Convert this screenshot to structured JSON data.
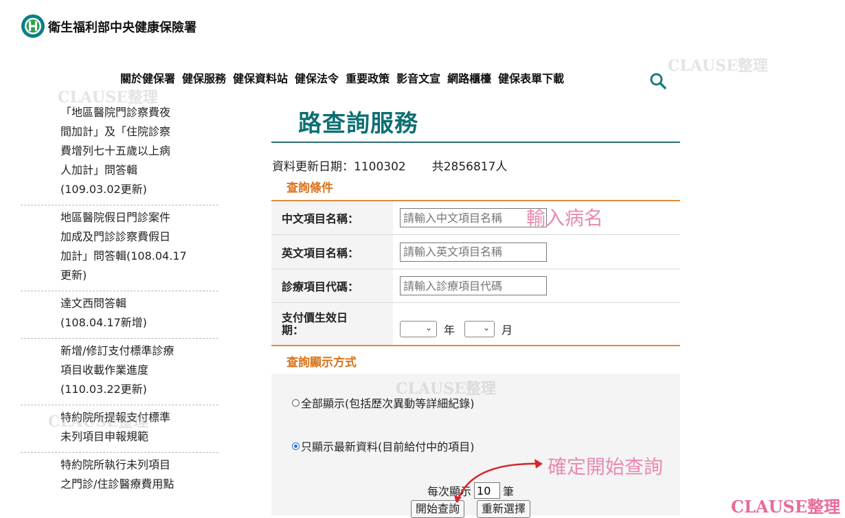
{
  "header": {
    "site_name": "衛生福利部中央健康保險署",
    "nav": [
      "關於健保署",
      "健保服務",
      "健保資料站",
      "健保法令",
      "重要政策",
      "影音文宣",
      "網路櫃檯",
      "健保表單下載"
    ]
  },
  "sidebar": {
    "items": [
      "「地區醫院門診察費夜\n間加計」及「住院診察\n費增列七十五歲以上病\n人加計」問答輯\n(109.03.02更新)",
      "地區醫院假日門診案件\n加成及門診診察費假日\n加計」問答輯(108.04.17\n更新)",
      "達文西問答輯\n(108.04.17新增)",
      "新增/修訂支付標準診療\n項目收載作業進度\n(110.03.22更新)",
      "特約院所提報支付標準\n未列項目申報規範",
      "特約院所執行未列項目\n之門診/住診醫療費用點"
    ]
  },
  "main": {
    "title": "路查詢服務",
    "update_label": "資料更新日期：1100302",
    "count_label": "共2856817人",
    "conditions_heading": "查詢條件",
    "fields": {
      "chinese_label": "中文項目名稱：",
      "chinese_placeholder": "請輸入中文項目名稱",
      "english_label": "英文項目名稱：",
      "english_placeholder": "請輸入英文項目名稱",
      "code_label": "診療項目代碼：",
      "code_placeholder": "請輸入診療項目代碼",
      "date_label": "支付價生效日\n期：",
      "year_unit": "年",
      "month_unit": "月"
    },
    "display_heading": "查詢顯示方式",
    "display_options": {
      "all": "全部顯示(包括歷次異動等詳細紀錄)",
      "latest": "只顯示最新資料(目前給付中的項目)",
      "selected": "latest"
    },
    "per_page": {
      "prefix": "每次顯示",
      "value": "10",
      "suffix": "筆"
    },
    "buttons": {
      "start": "開始查詢",
      "reset": "重新選擇"
    }
  },
  "annotations": {
    "input_hint": "輸入病名",
    "query_hint": "確定開始查詢",
    "watermark": "CLAUSE整理"
  },
  "colors": {
    "title_teal": "#0e6f73",
    "section_orange": "#d8731c",
    "table_border_orange": "#e08a3a",
    "annotation_pink": "#e98ab3",
    "arrow_red": "#d9262b",
    "search_icon_teal": "#1a7a86"
  }
}
